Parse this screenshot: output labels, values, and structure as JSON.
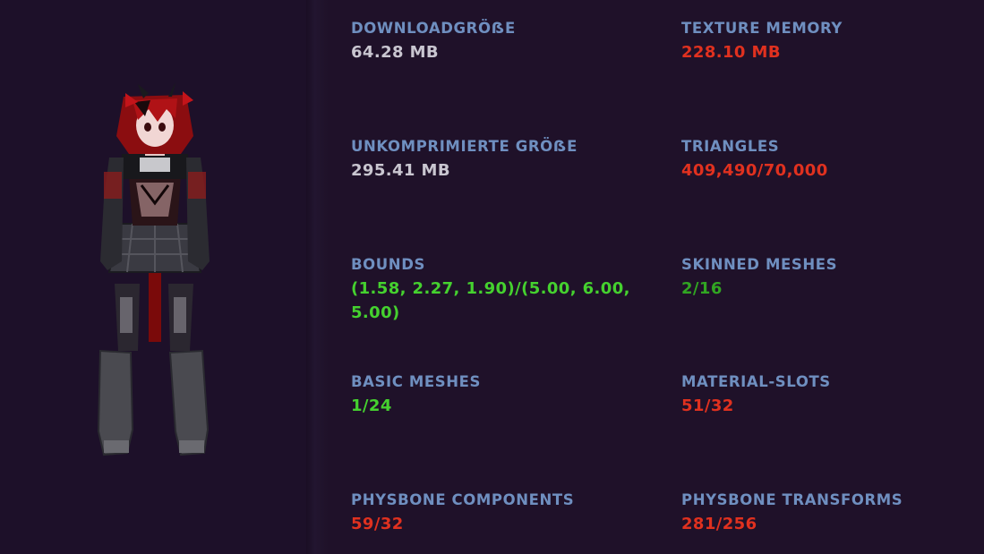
{
  "colors": {
    "background": "#1d1029",
    "label": "#6f8fc0",
    "neutral": "#c9c6d0",
    "bad": "#e0311f",
    "good": "#45d12f",
    "ok": "#31a522"
  },
  "avatar": {
    "icon": "avatar-preview-icon"
  },
  "stats": {
    "download_size": {
      "label": "DOWNLOADGRÖẞE",
      "value": "64.28 MB",
      "rating": "neutral"
    },
    "texture_memory": {
      "label": "TEXTURE MEMORY",
      "value": "228.10 MB",
      "rating": "bad"
    },
    "uncompressed_size": {
      "label": "UNKOMPRIMIERTE GRÖẞE",
      "value": "295.41 MB",
      "rating": "neutral"
    },
    "triangles": {
      "label": "TRIANGLES",
      "value": "409,490/70,000",
      "rating": "bad"
    },
    "bounds": {
      "label": "BOUNDS",
      "value_line1": "(1.58, 2.27, 1.90)/(5.00, 6.00,",
      "value_line2": "5.00)",
      "rating": "good"
    },
    "skinned_meshes": {
      "label": "SKINNED MESHES",
      "value": "2/16",
      "rating": "ok"
    },
    "basic_meshes": {
      "label": "BASIC MESHES",
      "value": "1/24",
      "rating": "good"
    },
    "material_slots": {
      "label": "MATERIAL-SLOTS",
      "value": "51/32",
      "rating": "bad"
    },
    "physbone_components": {
      "label": "PHYSBONE COMPONENTS",
      "value": "59/32",
      "rating": "bad"
    },
    "physbone_transforms": {
      "label": "PHYSBONE TRANSFORMS",
      "value": "281/256",
      "rating": "bad"
    }
  }
}
